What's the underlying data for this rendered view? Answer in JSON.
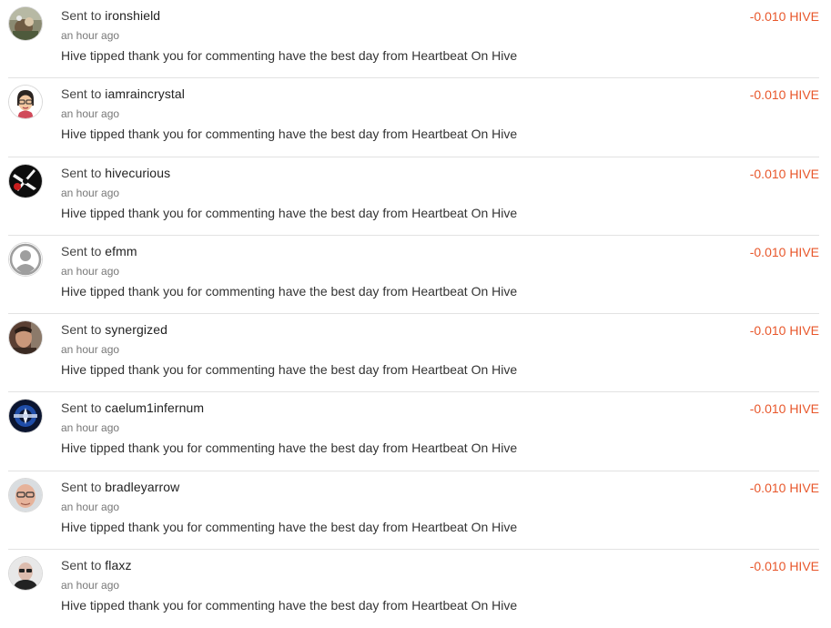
{
  "transfers": [
    {
      "sent_prefix": "Sent to",
      "username": "ironshield",
      "time": "an hour ago",
      "memo": "Hive tipped thank you for commenting have the best day from Heartbeat On Hive",
      "amount": "-0.010 HIVE",
      "avatar_icon": "avatar-ironshield-photo"
    },
    {
      "sent_prefix": "Sent to",
      "username": "iamraincrystal",
      "time": "an hour ago",
      "memo": "Hive tipped thank you for commenting have the best day from Heartbeat On Hive",
      "amount": "-0.010 HIVE",
      "avatar_icon": "avatar-iamraincrystal-cartoon"
    },
    {
      "sent_prefix": "Sent to",
      "username": "hivecurious",
      "time": "an hour ago",
      "memo": "Hive tipped thank you for commenting have the best day from Heartbeat On Hive",
      "amount": "-0.010 HIVE",
      "avatar_icon": "avatar-hivecurious-logo"
    },
    {
      "sent_prefix": "Sent to",
      "username": "efmm",
      "time": "an hour ago",
      "memo": "Hive tipped thank you for commenting have the best day from Heartbeat On Hive",
      "amount": "-0.010 HIVE",
      "avatar_icon": "default-user-icon"
    },
    {
      "sent_prefix": "Sent to",
      "username": "synergized",
      "time": "an hour ago",
      "memo": "Hive tipped thank you for commenting have the best day from Heartbeat On Hive",
      "amount": "-0.010 HIVE",
      "avatar_icon": "avatar-synergized-photo"
    },
    {
      "sent_prefix": "Sent to",
      "username": "caelum1infernum",
      "time": "an hour ago",
      "memo": "Hive tipped thank you for commenting have the best day from Heartbeat On Hive",
      "amount": "-0.010 HIVE",
      "avatar_icon": "avatar-caelum1infernum-emblem"
    },
    {
      "sent_prefix": "Sent to",
      "username": "bradleyarrow",
      "time": "an hour ago",
      "memo": "Hive tipped thank you for commenting have the best day from Heartbeat On Hive",
      "amount": "-0.010 HIVE",
      "avatar_icon": "avatar-bradleyarrow-photo"
    },
    {
      "sent_prefix": "Sent to",
      "username": "flaxz",
      "time": "an hour ago",
      "memo": "Hive tipped thank you for commenting have the best day from Heartbeat On Hive",
      "amount": "-0.010 HIVE",
      "avatar_icon": "avatar-flaxz-photo"
    }
  ],
  "colors": {
    "amount": "#e8572b",
    "divider": "#e2e2e2",
    "secondary_text": "#777777"
  }
}
